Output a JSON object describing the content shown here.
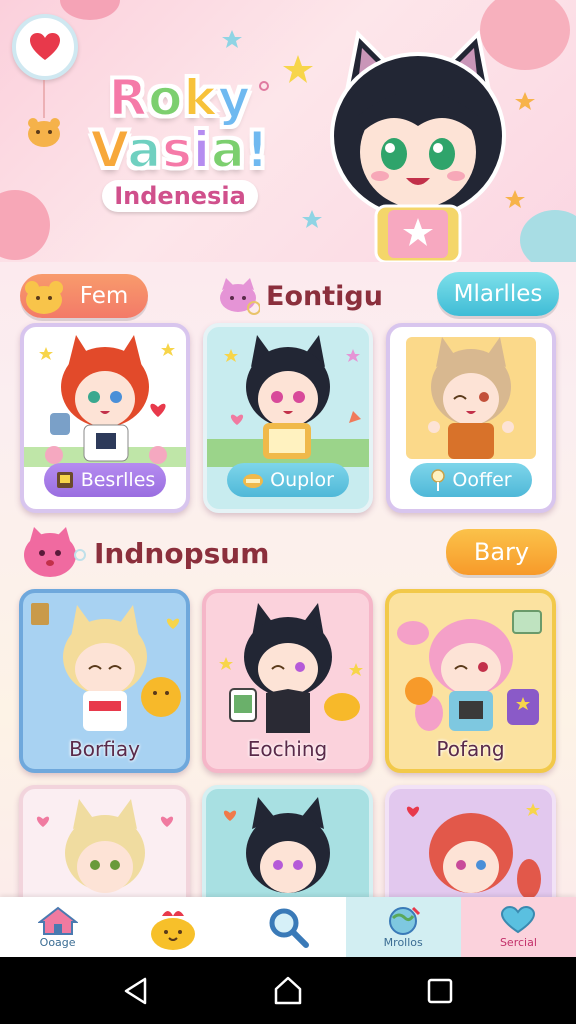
{
  "header": {
    "logo_line1": "Roky",
    "logo_line2": "Vasia!",
    "logo_sub": "Indenesia"
  },
  "section1": {
    "pill_left": "Fem",
    "title": "Eontigu",
    "pill_right": "Mlarlles",
    "cards": [
      {
        "tag": "Besrlles"
      },
      {
        "tag": "Ouplor"
      },
      {
        "tag": "Ooffer"
      }
    ]
  },
  "section2": {
    "title": "Indnopsum",
    "pill_right": "Bary",
    "cards": [
      {
        "label": "Borfiay"
      },
      {
        "label": "Eoching"
      },
      {
        "label": "Pofang"
      }
    ]
  },
  "nav": {
    "items": [
      {
        "label": "Ooage",
        "icon": "home-icon"
      },
      {
        "label": "",
        "icon": "gift-icon"
      },
      {
        "label": "",
        "icon": "search-icon"
      },
      {
        "label": "Mrollos",
        "icon": "globe-icon"
      },
      {
        "label": "Sercial",
        "icon": "heart-chat-icon"
      }
    ]
  },
  "colors": {
    "pink": "#f37fa6",
    "teal": "#4fc6e0",
    "orange": "#f8a23b",
    "purple": "#9a7ae0"
  }
}
